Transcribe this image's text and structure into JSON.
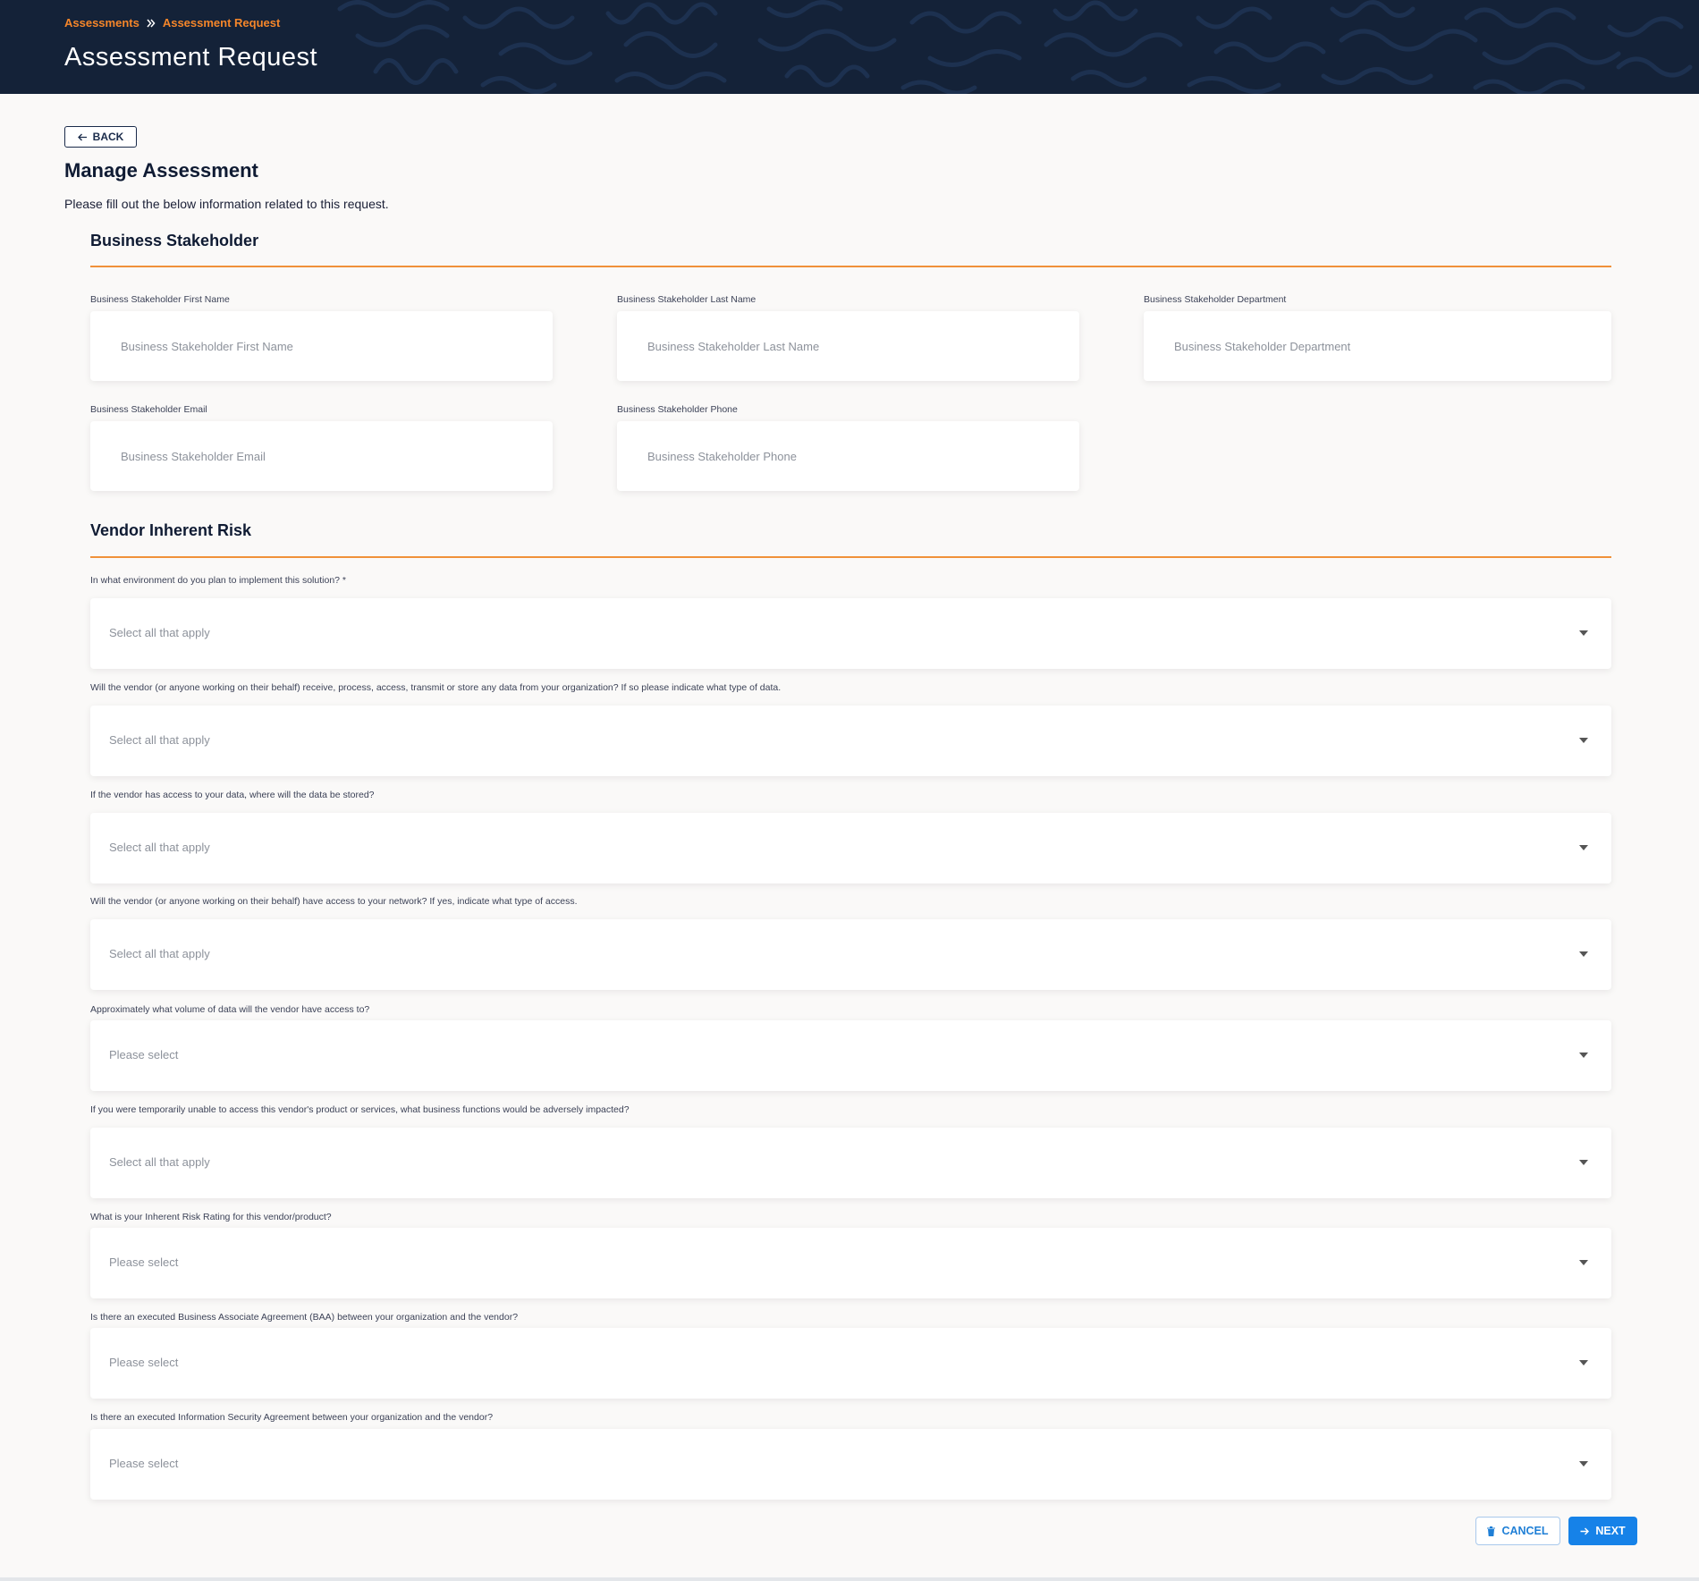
{
  "breadcrumb": {
    "items": [
      "Assessments",
      "Assessment Request"
    ]
  },
  "header": {
    "title": "Assessment Request"
  },
  "back_button": {
    "label": "BACK"
  },
  "main": {
    "title": "Manage Assessment",
    "intro": "Please fill out the below information related to this request."
  },
  "business_stakeholder": {
    "title": "Business Stakeholder",
    "fields": [
      {
        "label": "Business Stakeholder First Name",
        "placeholder": "Business Stakeholder First Name"
      },
      {
        "label": "Business Stakeholder Last Name",
        "placeholder": "Business Stakeholder Last Name"
      },
      {
        "label": "Business Stakeholder Department",
        "placeholder": "Business Stakeholder Department"
      },
      {
        "label": "Business Stakeholder Email",
        "placeholder": "Business Stakeholder Email"
      },
      {
        "label": "Business Stakeholder Phone",
        "placeholder": "Business Stakeholder Phone"
      }
    ]
  },
  "vendor_risk": {
    "title": "Vendor Inherent Risk",
    "questions": [
      {
        "label": "In what environment do you plan to implement this solution? *",
        "placeholder": "Select all that apply"
      },
      {
        "label": "Will the vendor (or anyone working on their behalf) receive, process, access, transmit or store any data from your organization? If so please indicate what type of data.",
        "placeholder": "Select all that apply"
      },
      {
        "label": "If the vendor has access to your data, where will the data be stored?",
        "placeholder": "Select all that apply"
      },
      {
        "label": "Will the vendor (or anyone working on their behalf) have access to your network? If yes, indicate what type of access.",
        "placeholder": "Select all that apply"
      },
      {
        "label": "Approximately what volume of data will the vendor have access to?",
        "placeholder": "Please select"
      },
      {
        "label": "If you were temporarily unable to access this vendor's product or services, what business functions would be adversely impacted?",
        "placeholder": "Select all that apply"
      },
      {
        "label": "What is your Inherent Risk Rating for this vendor/product?",
        "placeholder": "Please select"
      },
      {
        "label": "Is there an executed Business Associate Agreement (BAA) between your organization and the vendor?",
        "placeholder": "Please select"
      },
      {
        "label": "Is there an executed Information Security Agreement between your organization and the vendor?",
        "placeholder": "Please select"
      }
    ]
  },
  "actions": {
    "cancel_label": "CANCEL",
    "next_label": "NEXT"
  },
  "colors": {
    "accent": "#f5862a",
    "header_bg": "#142238",
    "primary": "#1682e8"
  },
  "icons": [
    "chevron-double-right-icon",
    "arrow-left-icon",
    "caret-down-icon",
    "trash-icon",
    "arrow-right-icon"
  ]
}
